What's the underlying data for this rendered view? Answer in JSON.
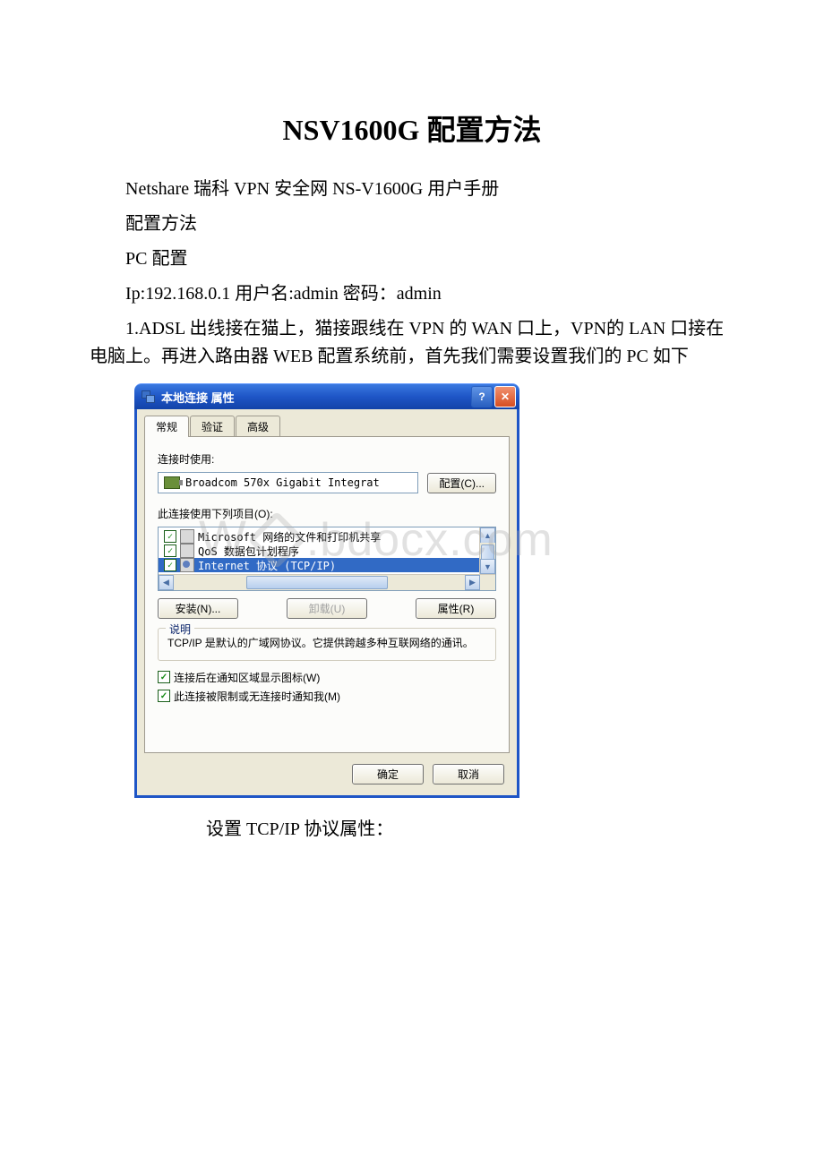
{
  "doc": {
    "title": "NSV1600G 配置方法",
    "line1": "Netshare 瑞科 VPN 安全网 NS-V1600G 用户手册",
    "line2": "配置方法",
    "line3": "PC 配置",
    "line4": "Ip:192.168.0.1   用户名:admin   密码：admin",
    "line5": "1.ADSL 出线接在猫上，猫接跟线在 VPN 的 WAN 口上，VPN的 LAN 口接在电脑上。再进入路由器 WEB 配置系统前，首先我们需要设置我们的 PC 如下",
    "caption": "设置 TCP/IP 协议属性："
  },
  "dialog": {
    "title": "本地连接 属性",
    "tabs": {
      "general": "常规",
      "auth": "验证",
      "advanced": "高级"
    },
    "connect_using": "连接时使用:",
    "adapter": "Broadcom 570x Gigabit Integrat",
    "configure": "配置(C)...",
    "items_label": "此连接使用下列项目(O):",
    "items": [
      {
        "checked": true,
        "text": "Microsoft 网络的文件和打印机共享",
        "selected": false
      },
      {
        "checked": true,
        "text": "QoS 数据包计划程序",
        "selected": false
      },
      {
        "checked": true,
        "text": "Internet 协议 (TCP/IP)",
        "selected": true
      }
    ],
    "install": "安装(N)...",
    "uninstall": "卸载(U)",
    "properties": "属性(R)",
    "group_label": "说明",
    "description": "TCP/IP 是默认的广域网协议。它提供跨越多种互联网络的通讯。",
    "show_icon": "连接后在通知区域显示图标(W)",
    "notify": "此连接被限制或无连接时通知我(M)",
    "ok": "确定",
    "cancel": "取消"
  },
  "watermark": {
    "text": ".bdocx.com"
  }
}
